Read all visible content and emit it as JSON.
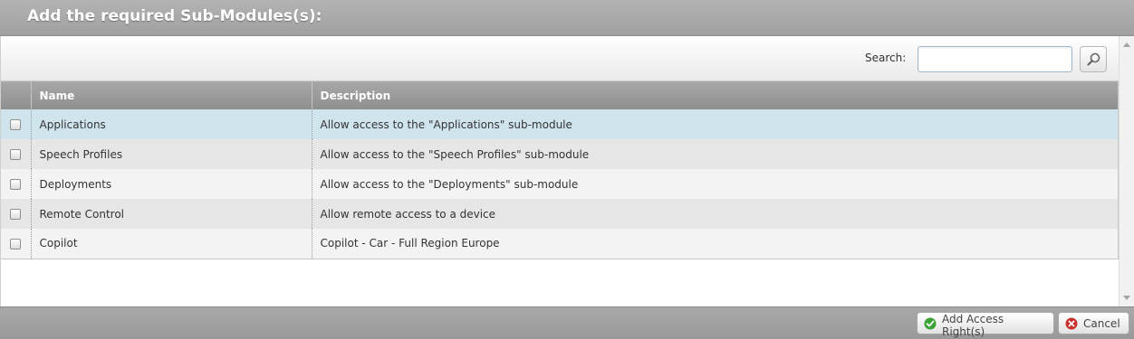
{
  "dialog": {
    "title": "Add the required Sub-Modules(s):"
  },
  "search": {
    "label": "Search:",
    "value": "",
    "placeholder": "",
    "icon": "magnifier-icon"
  },
  "table": {
    "columns": [
      "Name",
      "Description"
    ],
    "rows": [
      {
        "name": "Applications",
        "description": "Allow access to the \"Applications\" sub-module",
        "checked": false
      },
      {
        "name": "Speech Profiles",
        "description": "Allow access to the \"Speech Profiles\" sub-module",
        "checked": false
      },
      {
        "name": "Deployments",
        "description": "Allow access to the \"Deployments\" sub-module",
        "checked": false
      },
      {
        "name": "Remote Control",
        "description": "Allow  remote access to a device",
        "checked": false
      },
      {
        "name": "Copilot",
        "description": "Copilot - Car - Full Region Europe",
        "checked": false
      }
    ]
  },
  "footer": {
    "add_label": "Add Access Right(s)",
    "add_icon": "check-circle-icon",
    "cancel_label": "Cancel",
    "cancel_icon": "close-circle-icon"
  },
  "colors": {
    "header": "#a0a0a0",
    "row_highlight": "#d0e4ee",
    "add_icon": "#3ca335",
    "cancel_icon": "#c9302c"
  }
}
